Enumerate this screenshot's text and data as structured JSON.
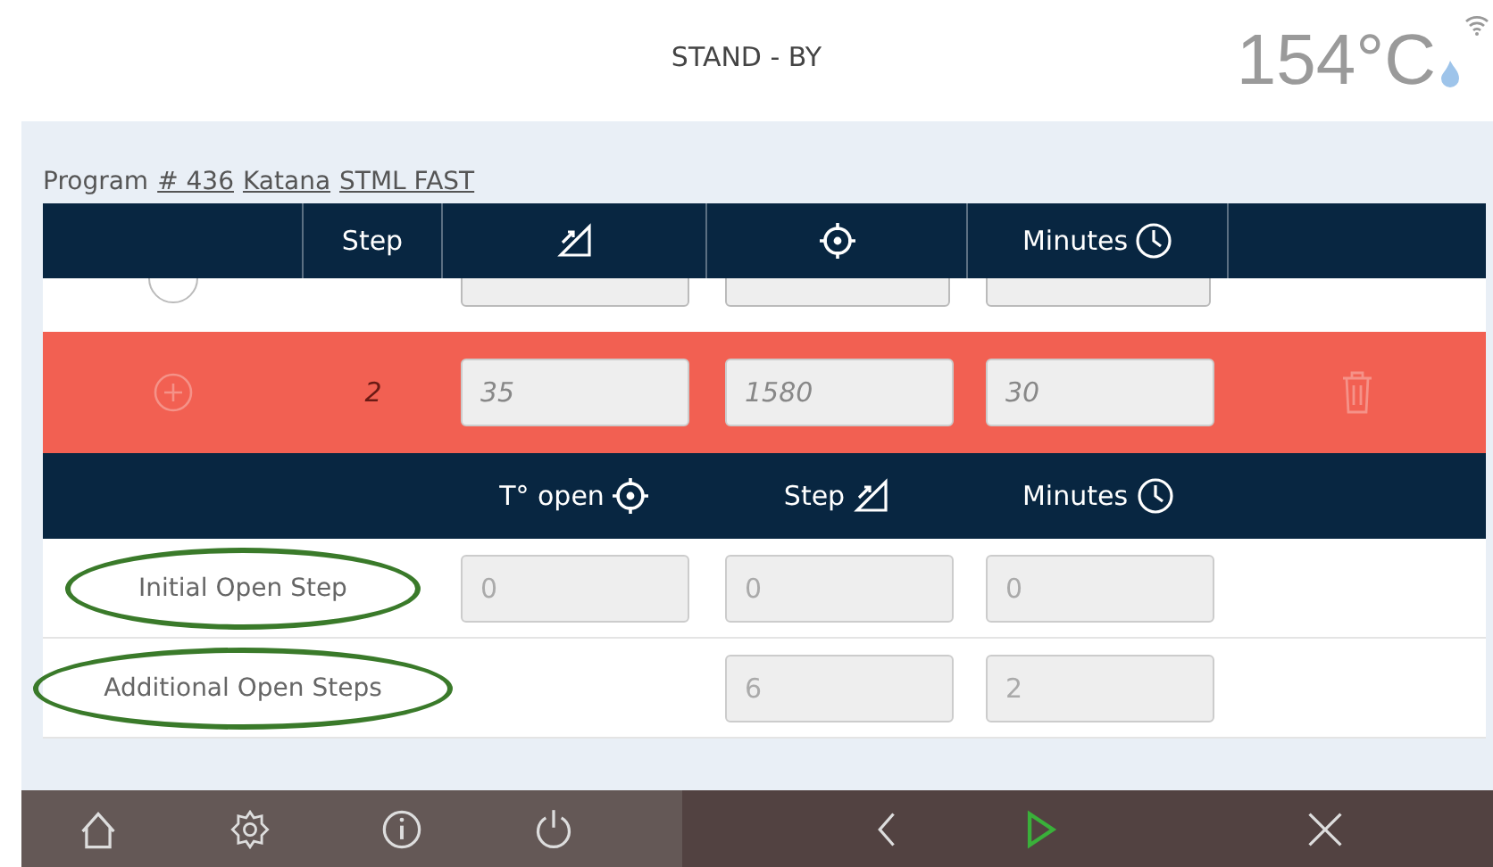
{
  "status_bar": {
    "state": "STAND - BY",
    "temperature": "154°C"
  },
  "program": {
    "label": "Program",
    "number": "# 436",
    "material": "Katana",
    "name": "STML FAST"
  },
  "steps_table": {
    "columns": [
      {
        "kind": "blank"
      },
      {
        "label": "Step",
        "kind": "text"
      },
      {
        "kind": "ramp"
      },
      {
        "kind": "target"
      },
      {
        "label": "Minutes",
        "kind": "clock"
      },
      {
        "kind": "blank"
      }
    ],
    "rows": [
      {
        "step": "2",
        "ramp": "35",
        "temperature": "1580",
        "minutes": "30",
        "selected": true
      }
    ]
  },
  "open_table": {
    "columns": [
      {
        "label": "T° open",
        "kind": "target"
      },
      {
        "label": "Step",
        "kind": "ramp"
      },
      {
        "label": "Minutes",
        "kind": "clock"
      }
    ],
    "rows": [
      {
        "label": "Initial Open Step",
        "t_open": "0",
        "step": "0",
        "minutes": "0",
        "circled": true
      },
      {
        "label": "Additional Open Steps",
        "step": "6",
        "minutes": "2",
        "circled": true
      }
    ]
  },
  "nav": {
    "left": [
      {
        "kind": "home"
      },
      {
        "kind": "settings"
      },
      {
        "kind": "info"
      },
      {
        "kind": "power"
      }
    ],
    "right": [
      {
        "kind": "back"
      },
      {
        "kind": "start"
      },
      {
        "kind": "close"
      }
    ]
  }
}
